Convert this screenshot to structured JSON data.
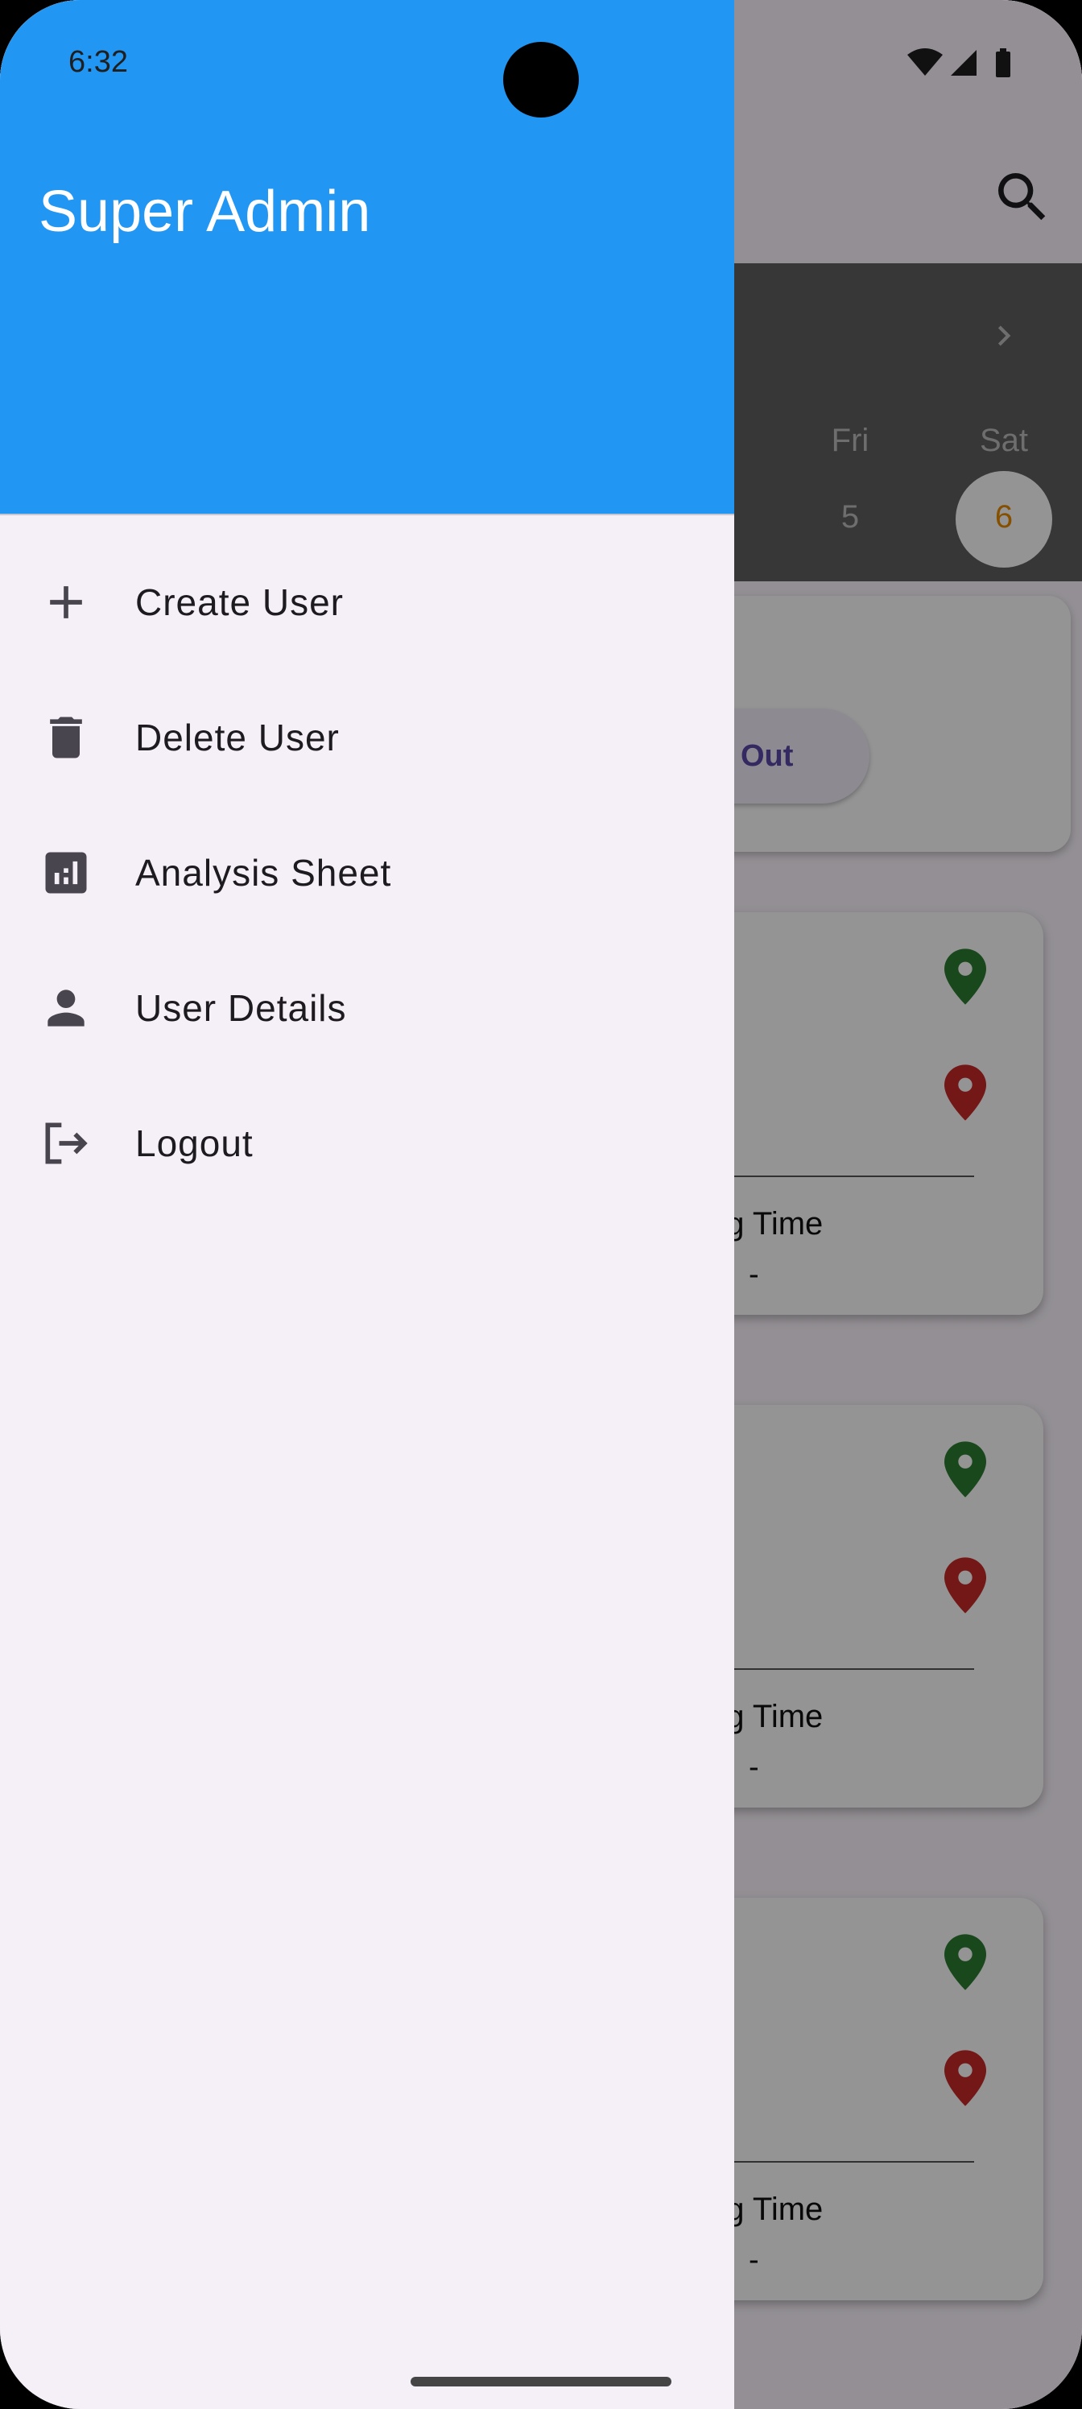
{
  "status_bar": {
    "time": "6:32"
  },
  "drawer": {
    "header_title": "Super Admin",
    "header_color": "#2196f3",
    "items": [
      {
        "label": "Create User",
        "icon": "add-icon"
      },
      {
        "label": "Delete User",
        "icon": "trash-icon"
      },
      {
        "label": "Analysis Sheet",
        "icon": "analytics-icon"
      },
      {
        "label": "User Details",
        "icon": "person-icon"
      },
      {
        "label": "Logout",
        "icon": "logout-icon"
      }
    ]
  },
  "background": {
    "calendar": {
      "weekdays": [
        "Fri",
        "Sat"
      ],
      "dates": [
        "5",
        "6"
      ],
      "selected_date": "6"
    },
    "attendance_button": "Out",
    "records": [
      {
        "title_fragment": "ng Time",
        "value": "-"
      },
      {
        "title_fragment": "ng Time",
        "value": "-"
      },
      {
        "title_fragment": "ng Time",
        "value": "-"
      }
    ]
  }
}
